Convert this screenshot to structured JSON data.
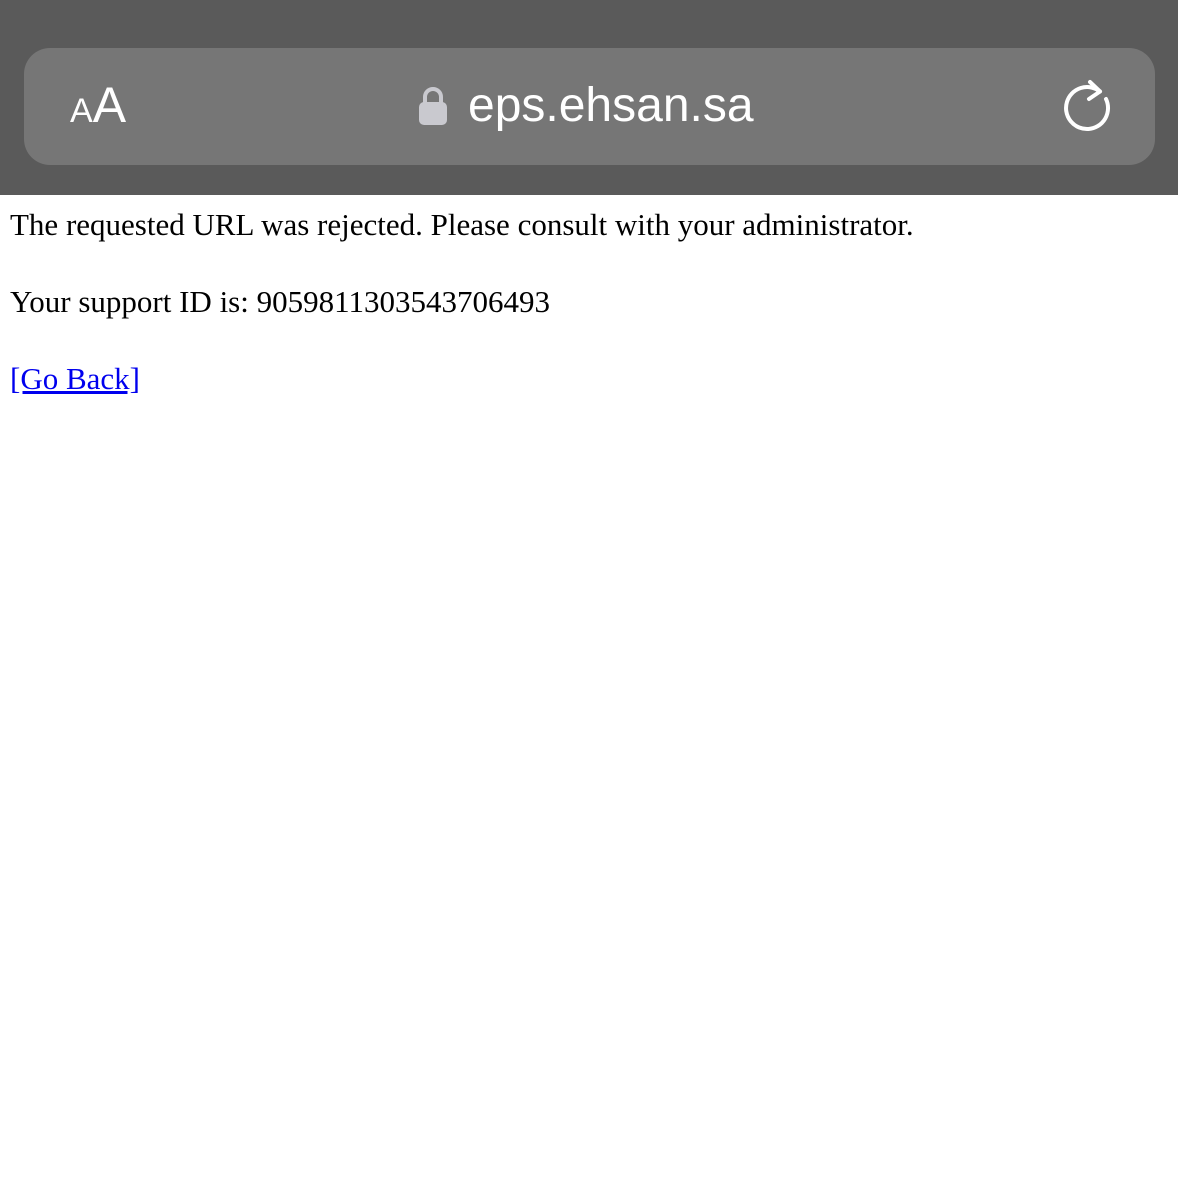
{
  "browser": {
    "text_size_small": "A",
    "text_size_large": "A",
    "url": "eps.ehsan.sa",
    "lock_icon": "lock-icon",
    "reload_icon": "reload-icon",
    "bar_color": "#5a5a5a",
    "field_color": "#767676"
  },
  "page": {
    "message": "The requested URL was rejected. Please consult with your administrator.",
    "support_label": "Your support ID is: ",
    "support_id": "9059811303543706493",
    "go_back_label": "[Go Back]",
    "link_color": "#0000ee"
  }
}
